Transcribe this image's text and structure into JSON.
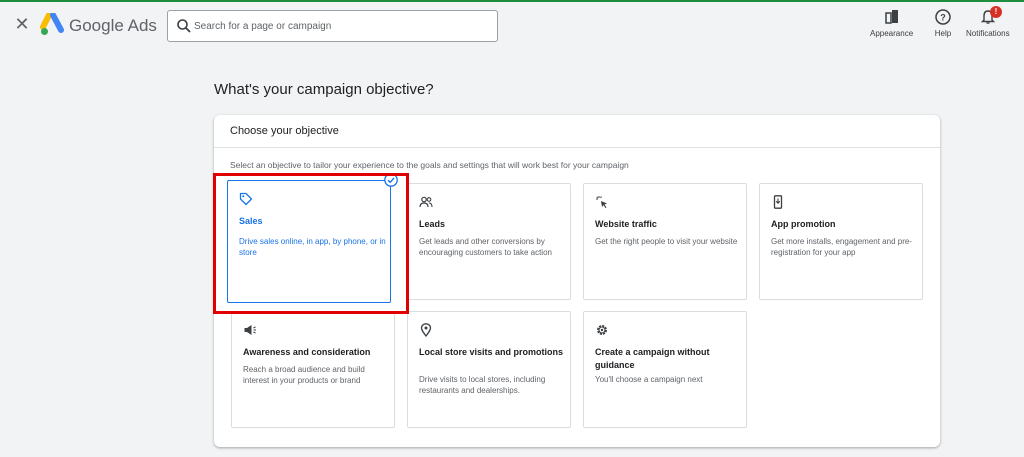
{
  "header": {
    "brand": "Google Ads",
    "search_placeholder": "Search for a page or campaign",
    "tools": [
      {
        "label": "Appearance",
        "icon": "appearance-icon"
      },
      {
        "label": "Help",
        "icon": "help-icon"
      },
      {
        "label": "Notifications",
        "icon": "bell-icon",
        "badge": "!"
      }
    ]
  },
  "main": {
    "title": "What's your campaign objective?",
    "panel_heading": "Choose your objective",
    "panel_description": "Select an objective to tailor your experience to the goals and settings that will work best for your campaign",
    "objectives": [
      {
        "title": "Sales",
        "description": "Drive sales online, in app, by phone, or in store",
        "icon": "tag-icon",
        "selected": true
      },
      {
        "title": "Leads",
        "description": "Get leads and other conversions by encouraging customers to take action",
        "icon": "people-icon",
        "selected": false
      },
      {
        "title": "Website traffic",
        "description": "Get the right people to visit your website",
        "icon": "cursor-click-icon",
        "selected": false
      },
      {
        "title": "App promotion",
        "description": "Get more installs, engagement and pre-registration for your app",
        "icon": "phone-download-icon",
        "selected": false
      },
      {
        "title": "Awareness and consideration",
        "description": "Reach a broad audience and build interest in your products or brand",
        "icon": "megaphone-icon",
        "selected": false
      },
      {
        "title": "Local store visits and promotions",
        "description": "Drive visits to local stores, including restaurants and dealerships.",
        "icon": "location-pin-icon",
        "selected": false
      },
      {
        "title": "Create a campaign without guidance",
        "description": "You'll choose a campaign next",
        "icon": "gear-icon",
        "selected": false
      }
    ]
  },
  "colors": {
    "accent": "#1a73e8",
    "highlight": "#e00000",
    "badge": "#d93025"
  }
}
